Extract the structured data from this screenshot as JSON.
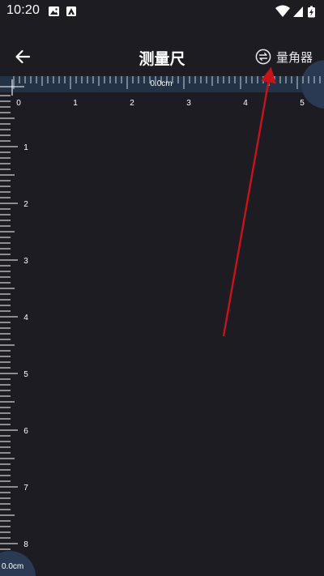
{
  "status_bar": {
    "time": "10:20",
    "left_icons": [
      "image-icon",
      "app-notification-icon"
    ],
    "right_icons": [
      "wifi-icon",
      "signal-icon",
      "battery-charging-icon"
    ]
  },
  "app_bar": {
    "title": "测量尺",
    "back_icon": "arrow-left-icon",
    "toggle_icon": "swap-circle-icon",
    "toggle_label": "量角器"
  },
  "ruler": {
    "unit": "cm",
    "horizontal_labels": [
      "0",
      "1",
      "2",
      "3",
      "4",
      "5"
    ],
    "vertical_labels": [
      "1",
      "2",
      "3",
      "4",
      "5",
      "6",
      "7",
      "8"
    ],
    "horizontal_readout": "0.0cm",
    "vertical_readout": "0.0cm"
  },
  "annotation": {
    "arrow_color": "#c8131a",
    "points_to": "toggle-protractor-button"
  },
  "colors": {
    "background": "#1d1c23",
    "ruler_band": "#243246",
    "tick": "#c6d2e2",
    "accent": "#c8131a"
  }
}
